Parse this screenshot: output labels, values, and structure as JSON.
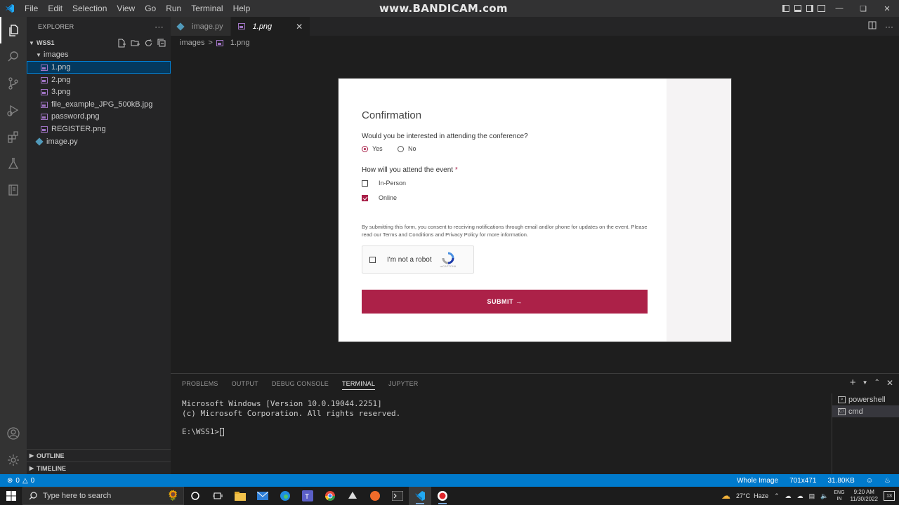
{
  "titlebar": {
    "menu": [
      "File",
      "Edit",
      "Selection",
      "View",
      "Go",
      "Run",
      "Terminal",
      "Help"
    ],
    "watermark": "www.BANDICAM.com"
  },
  "explorer": {
    "title": "EXPLORER",
    "more": "···",
    "folder": "WSS1",
    "subfolder": "images",
    "files": [
      "1.png",
      "2.png",
      "3.png",
      "file_example_JPG_500kB.jpg",
      "password.png",
      "REGISTER.png"
    ],
    "root_file": "image.py",
    "outline": "OUTLINE",
    "timeline": "TIMELINE"
  },
  "tabs": [
    {
      "label": "image.py",
      "active": false
    },
    {
      "label": "1.png",
      "active": true
    }
  ],
  "breadcrumb": {
    "folder": "images",
    "sep": ">",
    "file": "1.png"
  },
  "preview": {
    "title": "Confirmation",
    "question1": "Would you be interested in attending the conference?",
    "yes": "Yes",
    "no": "No",
    "question2": "How will you attend the event",
    "required_mark": "*",
    "opt_inperson": "In-Person",
    "opt_online": "Online",
    "consent": "By submitting this form, you consent to receiving notifications through email and/or phone for updates on the event. Please read our Terms and Conditions and Privacy Policy for more information.",
    "captcha_label": "I'm not a robot",
    "captcha_small": "reCAPTCHA",
    "submit": "SUBMIT →"
  },
  "panel": {
    "tabs": [
      "PROBLEMS",
      "OUTPUT",
      "DEBUG CONSOLE",
      "TERMINAL",
      "JUPYTER"
    ],
    "active_tab": "TERMINAL",
    "terminal_lines": [
      "Microsoft Windows [Version 10.0.19044.2251]",
      "(c) Microsoft Corporation. All rights reserved."
    ],
    "prompt": "E:\\WSS1>",
    "terminals": [
      "powershell",
      "cmd"
    ]
  },
  "statusbar": {
    "errors": "0",
    "warnings": "0",
    "view": "Whole Image",
    "dimensions": "701x471",
    "size": "31.80KB"
  },
  "taskbar": {
    "search_placeholder": "Type here to search",
    "weather": "27°C  Haze",
    "lang_top": "ENG",
    "lang_bottom": "IN",
    "time": "9:20 AM",
    "date": "11/30/2022",
    "notifications": "13"
  },
  "colors": {
    "accent": "#007acc",
    "form_accent": "#ac2148"
  }
}
